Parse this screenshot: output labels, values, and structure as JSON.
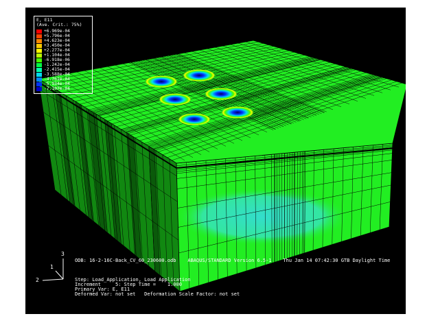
{
  "legend": {
    "title": "E, E11",
    "criterion": "(Ave. Crit.: 75%)",
    "entries": [
      {
        "value": "+6.969e-04",
        "color": "#ff0000"
      },
      {
        "value": "+5.796e-04",
        "color": "#ff4400"
      },
      {
        "value": "+4.623e-04",
        "color": "#ff8800"
      },
      {
        "value": "+3.450e-04",
        "color": "#ffcc00"
      },
      {
        "value": "+2.277e-04",
        "color": "#ffff00"
      },
      {
        "value": "+1.104e-04",
        "color": "#b8ff00"
      },
      {
        "value": "-6.918e-06",
        "color": "#44ff00"
      },
      {
        "value": "-1.242e-04",
        "color": "#00ff44"
      },
      {
        "value": "-2.415e-04",
        "color": "#00ffaa"
      },
      {
        "value": "-3.588e-04",
        "color": "#00ddee"
      },
      {
        "value": "-4.761e-04",
        "color": "#0088ff"
      },
      {
        "value": "-5.934e-04",
        "color": "#0033ff"
      },
      {
        "value": "-7.107e-04",
        "color": "#0000cc"
      }
    ]
  },
  "info": {
    "odb": "ODB: 16-2-16C-Back_CV_60_230600.odb    ABAQUS/STANDARD Version 6.5-1    Thu Jan 14 07:42:30 GTB Daylight Time",
    "step": "Step: Load_Application, Load Application",
    "increment": "Increment     5: Step Time =    1.000",
    "primary_var": "Primary Var: E, E11",
    "deformed_var": "Deformed Var: not set   Deformation Scale Factor: not set"
  },
  "triad": {
    "x": "1",
    "y": "2",
    "z": "3"
  },
  "colors": {
    "background": "#000000",
    "model": "#22ee22",
    "mesh": "#000000",
    "text": "#ffffff"
  }
}
